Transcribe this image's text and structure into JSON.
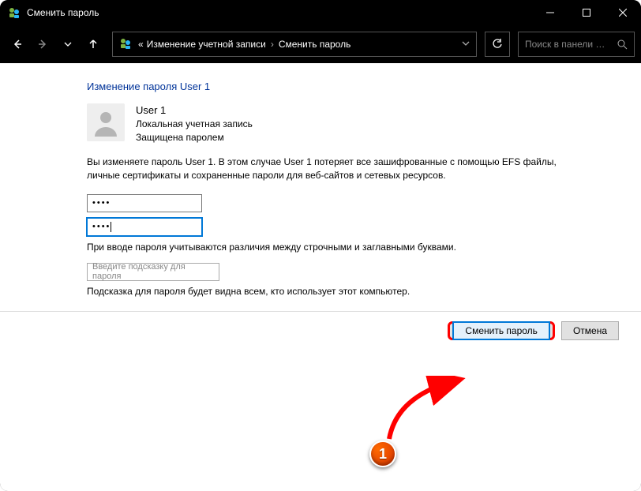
{
  "window": {
    "title": "Сменить пароль"
  },
  "breadcrumb": {
    "prefix": "«",
    "part1": "Изменение учетной записи",
    "part2": "Сменить пароль"
  },
  "search": {
    "placeholder": "Поиск в панели …"
  },
  "page": {
    "heading": "Изменение пароля User 1",
    "user": {
      "name": "User 1",
      "type": "Локальная учетная запись",
      "status": "Защищена паролем"
    },
    "description": "Вы изменяете пароль User 1. В этом случае User 1 потеряет все зашифрованные с помощью EFS файлы, личные сертификаты и сохраненные пароли для веб-сайтов и сетевых ресурсов.",
    "pw1": "••••",
    "pw2": "••••",
    "note_case": "При вводе пароля учитываются различия между строчными и заглавными буквами.",
    "hint_placeholder": "Введите подсказку для пароля",
    "note_hint": "Подсказка для пароля будет видна всем, кто использует этот компьютер.",
    "btn_primary": "Сменить пароль",
    "btn_cancel": "Отмена"
  },
  "annotation": {
    "badge": "1"
  }
}
